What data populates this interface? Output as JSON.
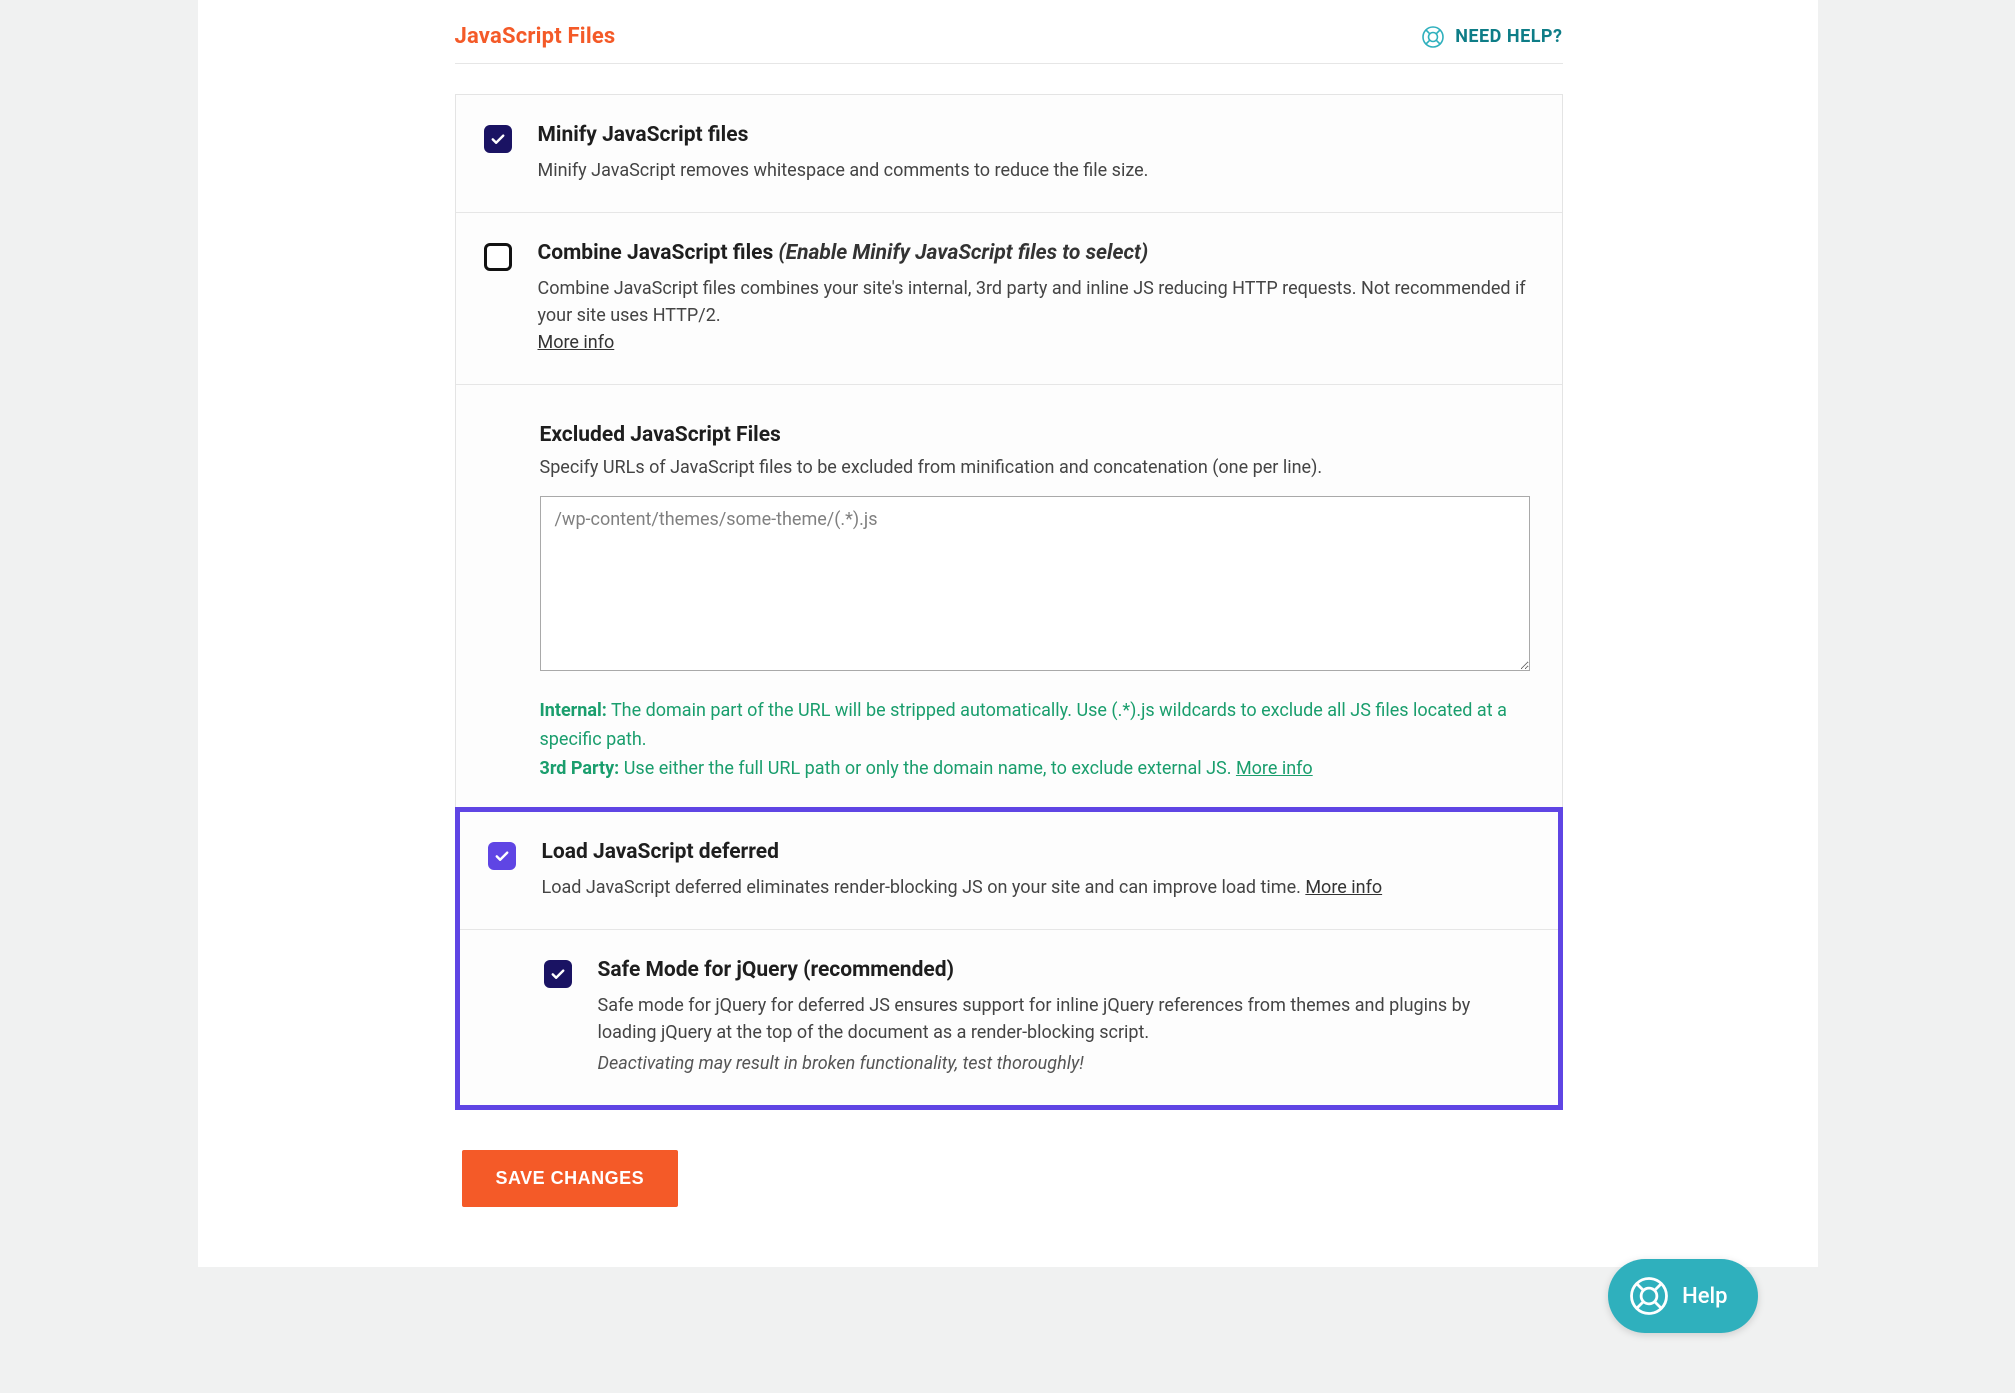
{
  "header": {
    "section_title": "JavaScript Files",
    "help_label": "NEED HELP?"
  },
  "options": {
    "minify": {
      "title": "Minify JavaScript files",
      "desc": "Minify JavaScript removes whitespace and comments to reduce the file size."
    },
    "combine": {
      "title": "Combine JavaScript files",
      "note": "(Enable Minify JavaScript files to select)",
      "desc": "Combine JavaScript files combines your site's internal, 3rd party and inline JS reducing HTTP requests. Not recommended if your site uses HTTP/2.",
      "more": "More info"
    },
    "excluded": {
      "title": "Excluded JavaScript Files",
      "desc": "Specify URLs of JavaScript files to be excluded from minification and concatenation (one per line).",
      "placeholder": "/wp-content/themes/some-theme/(.*).js",
      "hint1_label": "Internal:",
      "hint1_text": " The domain part of the URL will be stripped automatically. Use (.*).js wildcards to exclude all JS files located at a specific path.",
      "hint2_label": "3rd Party:",
      "hint2_text": " Use either the full URL path or only the domain name, to exclude external JS. ",
      "hint2_more": "More info"
    },
    "defer": {
      "title": "Load JavaScript deferred",
      "desc": "Load JavaScript deferred eliminates render-blocking JS on your site and can improve load time. ",
      "more": "More info"
    },
    "safemode": {
      "title": "Safe Mode for jQuery (recommended)",
      "desc": "Safe mode for jQuery for deferred JS ensures support for inline jQuery references from themes and plugins by loading jQuery at the top of the document as a render-blocking script.",
      "warn": "Deactivating may result in broken functionality, test thoroughly!"
    }
  },
  "save_label": "SAVE CHANGES",
  "fab": {
    "label": "Help"
  }
}
